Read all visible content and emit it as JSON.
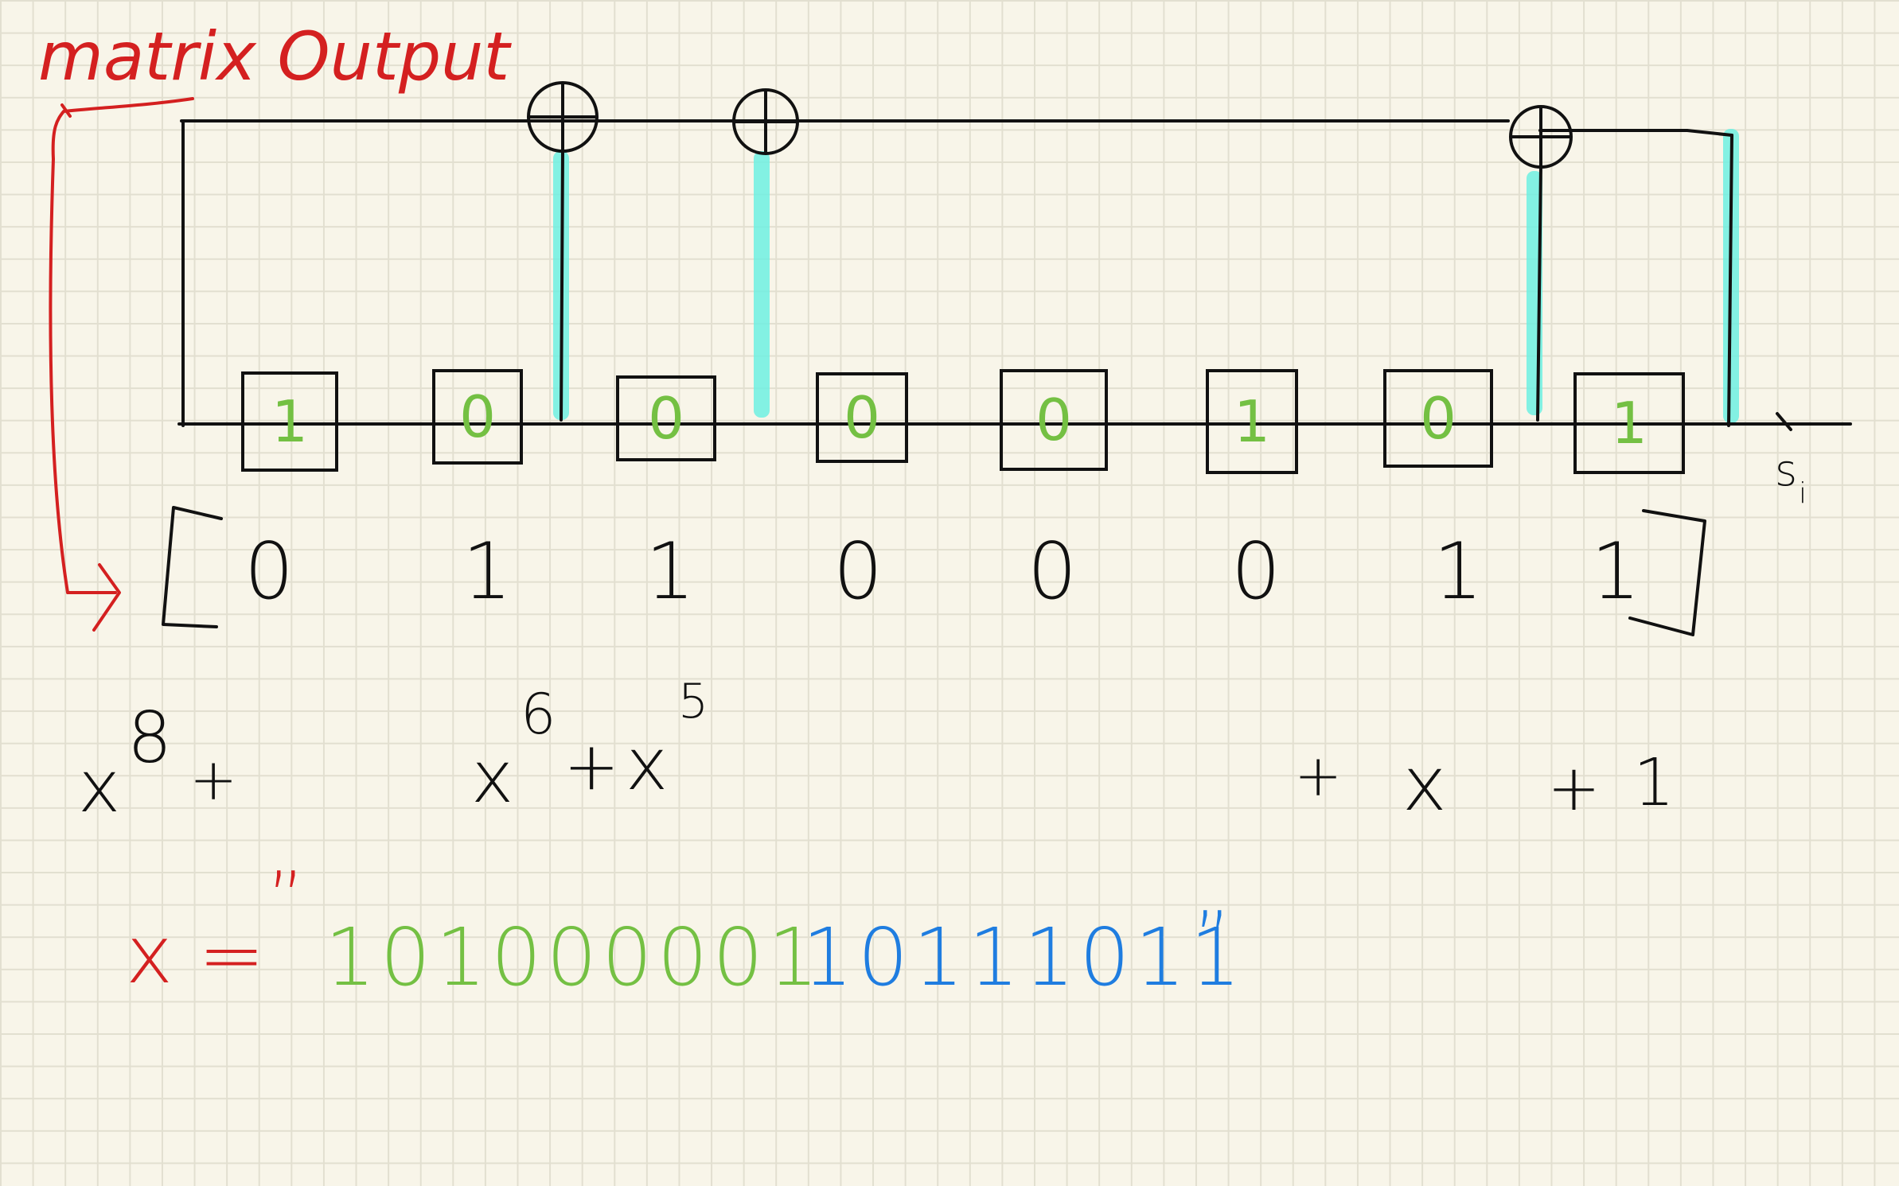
{
  "annotation": {
    "label": "matrix Output",
    "color": "#d42020"
  },
  "register": {
    "bits": [
      "1",
      "0",
      "0",
      "0",
      "0",
      "1",
      "0",
      "1"
    ],
    "bit_color": "#74c043",
    "output_label": "s",
    "output_subscript": "i",
    "tap_highlight_color": "#6ef0e2"
  },
  "matrix_row": {
    "values": [
      "0",
      "1",
      "1",
      "0",
      "0",
      "0",
      "1",
      "1"
    ]
  },
  "polynomial": {
    "t1_base": "x",
    "t1_exp": "8",
    "plus1": "+",
    "t2_base": "x",
    "t2_exp": "6",
    "plus2": "+",
    "t3_base": "x",
    "t3_exp": "5",
    "plus3": "+",
    "t4": "x",
    "plus4": "+",
    "t5": "1"
  },
  "sequence": {
    "prefix": "x = ",
    "open_quote": "”",
    "green_part": "101000001",
    "blue_part": "10111011",
    "close_quote": "”",
    "prefix_color": "#d42020",
    "green_color": "#74c043",
    "blue_color": "#1f7de0"
  }
}
